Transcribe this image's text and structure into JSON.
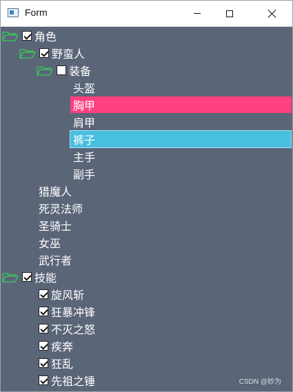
{
  "window": {
    "title": "Form",
    "controls": [
      "minimize-icon",
      "maximize-icon",
      "close-icon"
    ]
  },
  "tree": {
    "role": {
      "label": "角色",
      "checked": true,
      "barbarian": {
        "label": "野蛮人",
        "checked": true,
        "equipment": {
          "label": "装备",
          "checked": false,
          "items": [
            "头盔",
            "胸甲",
            "肩甲",
            "裤子",
            "主手",
            "副手"
          ]
        }
      },
      "others": [
        "猎魔人",
        "死灵法师",
        "圣骑士",
        "女巫",
        "武行者"
      ]
    },
    "skills": {
      "label": "技能",
      "checked": true,
      "items": [
        "旋风斩",
        "狂暴冲锋",
        "不灭之怒",
        "疾奔",
        "狂乱",
        "先祖之锤"
      ]
    }
  },
  "colors": {
    "background": "#5b6578",
    "selected_pink": "#ff4081",
    "selected_blue": "#49bfe0",
    "folder_icon": "#3cc25a"
  },
  "watermark": "CSDN @妙为"
}
